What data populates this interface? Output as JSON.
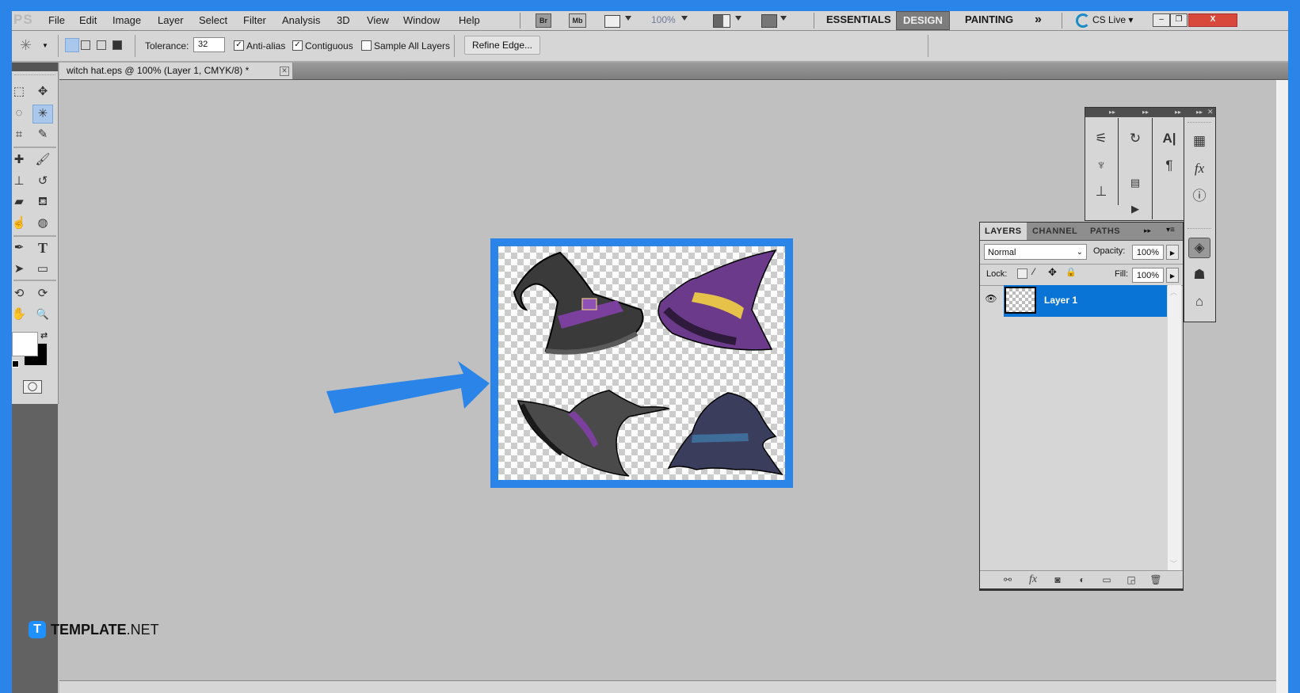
{
  "app": {
    "logo": "PS",
    "menu": [
      "File",
      "Edit",
      "Image",
      "Layer",
      "Select",
      "Filter",
      "Analysis",
      "3D",
      "View",
      "Window",
      "Help"
    ],
    "bridge_buttons": [
      "Br",
      "Mb"
    ],
    "zoom_level": "100%",
    "workspaces": [
      "ESSENTIALS",
      "DESIGN",
      "PAINTING"
    ],
    "active_workspace": "DESIGN",
    "more_workspaces": "»",
    "cs_live": "CS Live ▾",
    "window_buttons": {
      "minimize": "–",
      "restore": "❐",
      "close": "X"
    }
  },
  "options_bar": {
    "tool_icon": "quick-selection-icon",
    "tolerance_label": "Tolerance:",
    "tolerance_value": "32",
    "anti_alias": {
      "label": "Anti-alias",
      "checked": true
    },
    "contiguous": {
      "label": "Contiguous",
      "checked": true
    },
    "sample_all_layers": {
      "label": "Sample All Layers",
      "checked": false
    },
    "refine_edge_label": "Refine Edge..."
  },
  "document": {
    "tab_title": "witch hat.eps @ 100% (Layer 1, CMYK/8) *",
    "image_description": "Four witch hats on transparent background"
  },
  "tools": [
    {
      "name": "rectangular-marquee",
      "glyph": "⬚"
    },
    {
      "name": "move",
      "glyph": "✥"
    },
    {
      "name": "lasso",
      "glyph": "◌"
    },
    {
      "name": "quick-selection",
      "glyph": "✳"
    },
    {
      "name": "crop",
      "glyph": "⌗"
    },
    {
      "name": "eyedropper",
      "glyph": "✎"
    },
    {
      "name": "healing-brush",
      "glyph": "✚"
    },
    {
      "name": "brush",
      "glyph": "🖌"
    },
    {
      "name": "clone-stamp",
      "glyph": "⊥"
    },
    {
      "name": "history-brush",
      "glyph": "↺"
    },
    {
      "name": "eraser",
      "glyph": "▰"
    },
    {
      "name": "paint-bucket",
      "glyph": "⛾"
    },
    {
      "name": "smudge",
      "glyph": "☝"
    },
    {
      "name": "sponge",
      "glyph": "◍"
    },
    {
      "name": "pen",
      "glyph": "✒"
    },
    {
      "name": "type",
      "glyph": "T"
    },
    {
      "name": "path-selection",
      "glyph": "➤"
    },
    {
      "name": "rectangle",
      "glyph": "▭"
    },
    {
      "name": "3d-rotate",
      "glyph": "⟲"
    },
    {
      "name": "3d-orbit",
      "glyph": "⟳"
    },
    {
      "name": "hand",
      "glyph": "✋"
    },
    {
      "name": "zoom",
      "glyph": "🔍"
    }
  ],
  "colors": {
    "foreground": "#ffffff",
    "background": "#000000",
    "accent": "#2b84e8",
    "selection": "#0a74d6"
  },
  "layers_panel": {
    "tabs": [
      "LAYERS",
      "CHANNEL",
      "PATHS"
    ],
    "active_tab": "LAYERS",
    "blend_mode": "Normal",
    "opacity_label": "Opacity:",
    "opacity_value": "100%",
    "lock_label": "Lock:",
    "fill_label": "Fill:",
    "fill_value": "100%",
    "layers": [
      {
        "name": "Layer 1",
        "visible": true,
        "selected": true
      }
    ],
    "footer_icons": [
      "link-layers-icon",
      "fx-icon",
      "layer-mask-icon",
      "adjustment-layer-icon",
      "new-group-icon",
      "new-layer-icon",
      "delete-layer-icon"
    ]
  },
  "watermark": {
    "brand": "TEMPLATE",
    "suffix": ".NET",
    "logo_letter": "T"
  }
}
